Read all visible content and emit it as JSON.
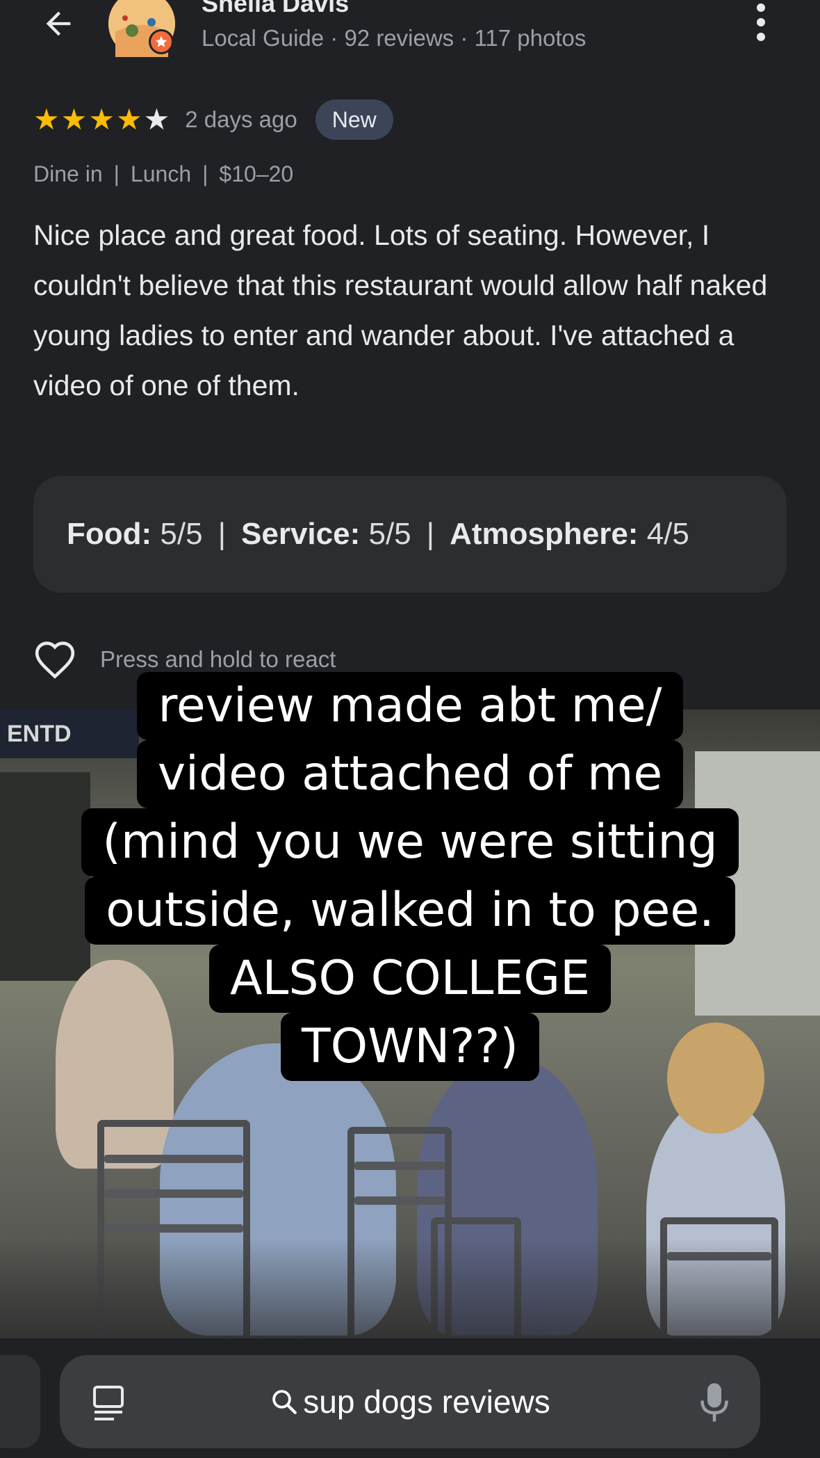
{
  "reviewer": {
    "name": "Sheila Davis",
    "meta": "Local Guide · 92 reviews · 117 photos"
  },
  "review": {
    "stars": 4,
    "max_stars": 5,
    "time_ago": "2 days ago",
    "badge": "New",
    "visit_tags": [
      "Dine in",
      "Lunch",
      "$10–20"
    ],
    "text": "Nice place and great food. Lots of seating. However, I couldn't believe that this restaurant would allow half naked young ladies to enter and wander about. I've attached a video of one of them.",
    "ratings": [
      {
        "label": "Food:",
        "value": "5/5"
      },
      {
        "label": "Service:",
        "value": "5/5"
      },
      {
        "label": "Atmosphere:",
        "value": "4/5"
      }
    ],
    "react_label": "Press and hold to react"
  },
  "caption": {
    "lines": [
      "review made abt me/",
      "video attached of me",
      "(mind you we were sitting",
      "outside, walked in to pee.",
      "ALSO COLLEGE",
      "TOWN??)"
    ]
  },
  "photo": {
    "sign_text": "ENTD"
  },
  "search": {
    "query": "sup dogs reviews"
  },
  "colors": {
    "background": "#202124",
    "star": "#fbbc04",
    "badge": "#3c4458",
    "caption_bg": "#000000"
  },
  "icons": [
    "back-arrow-icon",
    "more-vert-icon",
    "star-icon",
    "heart-icon",
    "tabs-icon",
    "search-icon",
    "mic-icon"
  ]
}
